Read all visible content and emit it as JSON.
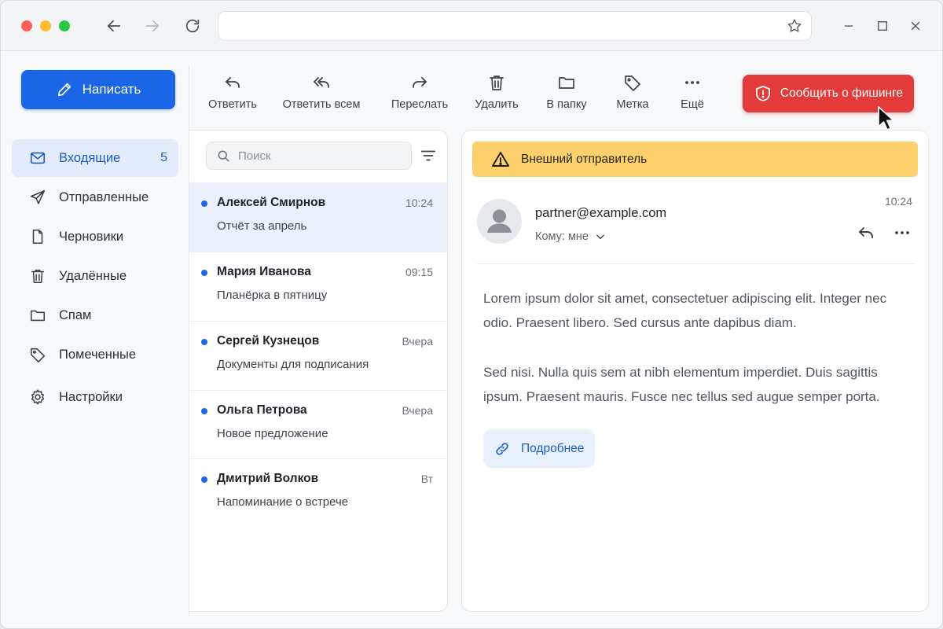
{
  "toolbar": {
    "compose_label": "Написать",
    "reply_label": "Ответить",
    "reply_all_label": "Ответить всем",
    "forward_label": "Переслать",
    "delete_label": "Удалить",
    "move_label": "В папку",
    "tag_label": "Метка",
    "more_label": "Ещё",
    "phishing_label": "Сообщить о фишинге"
  },
  "sidebar": {
    "items": [
      {
        "label": "Входящие",
        "icon": "mail-icon",
        "count": "5"
      },
      {
        "label": "Отправленные",
        "icon": "send-icon"
      },
      {
        "label": "Черновики",
        "icon": "draft-icon"
      },
      {
        "label": "Удалённые",
        "icon": "trash-icon"
      },
      {
        "label": "Спам",
        "icon": "folder-icon"
      },
      {
        "label": "Помеченные",
        "icon": "tag-icon"
      },
      {
        "label": "Настройки",
        "icon": "gear-icon"
      }
    ]
  },
  "search": {
    "placeholder": "Поиск"
  },
  "messages": [
    {
      "sender": "Алексей Смирнов",
      "time": "10:24",
      "subject": "Отчёт за апрель"
    },
    {
      "sender": "Мария Иванова",
      "time": "09:15",
      "subject": "Планёрка в пятницу"
    },
    {
      "sender": "Сергей Кузнецов",
      "time": "Вчера",
      "subject": "Документы для подписания"
    },
    {
      "sender": "Ольга Петрова",
      "time": "Вчера",
      "subject": "Новое предложение"
    },
    {
      "sender": "Дмитрий Волков",
      "time": "Вт",
      "subject": "Напоминание о встрече"
    }
  ],
  "reading": {
    "warning": "Внешний отправитель",
    "from": "partner@example.com",
    "to": "Кому: мне",
    "time": "10:24",
    "body": [
      "Lorem ipsum dolor sit amet, consectetuer adipiscing elit. Integer nec odio. Praesent libero. Sed cursus ante dapibus diam.",
      "Sed nisi. Nulla quis sem at nibh elementum imperdiet. Duis sagittis ipsum. Praesent mauris. Fusce nec tellus sed augue semper porta."
    ],
    "more_label": "Подробнее"
  },
  "colors": {
    "accent": "#1a66e6",
    "danger": "#e33a3a",
    "warning": "#fcd16b"
  }
}
